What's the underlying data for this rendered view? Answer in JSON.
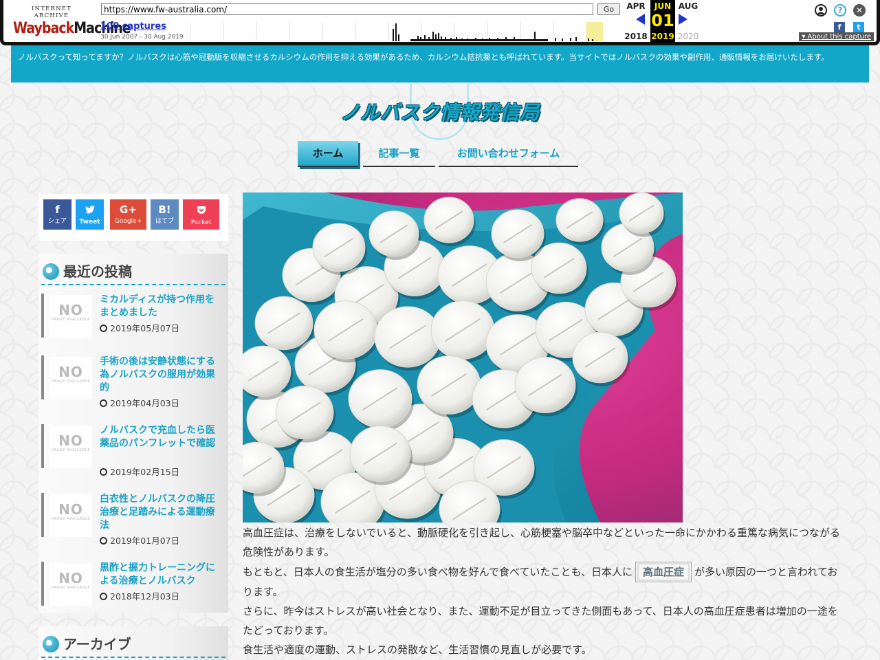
{
  "wayback": {
    "logo_top": "INTERNET ARCHIVE",
    "logo_main_1": "Wayback",
    "logo_main_2": "Machine",
    "url": "https://www.fw-australia.com/",
    "go_label": "Go",
    "captures": "100 captures",
    "range": "30 Jun 2007 - 30 Aug 2019",
    "months": {
      "prev": "APR",
      "current": "JUN",
      "next": "AUG"
    },
    "day": "01",
    "years": {
      "prev": "2018",
      "current": "2019",
      "next": "2020"
    },
    "about": "About this capture",
    "icons": [
      "user-icon",
      "help-icon",
      "close-icon",
      "facebook-icon",
      "twitter-icon"
    ],
    "sparkline": [
      0,
      0,
      0,
      0,
      0,
      0,
      0,
      0,
      0,
      0,
      0,
      0,
      0,
      0,
      0,
      0,
      0,
      0,
      0,
      0,
      0,
      0,
      0,
      0,
      0,
      0,
      0,
      0,
      0,
      0,
      0,
      0,
      0,
      0,
      0,
      0,
      0,
      0,
      0,
      0,
      0,
      0,
      0,
      0,
      0,
      0,
      0,
      0,
      0,
      0,
      0,
      0,
      0,
      0,
      0,
      0,
      0,
      0,
      0,
      0,
      0,
      0,
      0,
      0,
      0,
      0,
      0,
      0,
      0,
      0,
      0,
      0,
      0,
      0,
      0,
      0,
      0,
      0,
      0,
      0,
      0,
      0,
      0,
      0,
      0,
      0,
      0,
      0,
      0,
      0,
      0,
      0,
      0,
      0,
      0,
      0,
      0,
      0,
      0,
      0,
      0,
      0,
      0,
      0,
      0,
      0,
      0,
      0,
      0,
      0,
      0,
      0,
      0,
      0,
      0,
      0,
      0,
      0,
      0,
      0,
      0,
      0,
      0,
      0,
      0,
      0,
      0,
      0,
      0,
      0,
      0,
      0,
      0,
      0,
      0,
      0,
      0,
      0,
      0,
      0,
      0,
      0,
      0,
      0,
      0,
      0,
      0,
      0,
      0,
      0,
      0,
      0,
      0,
      0,
      0,
      0,
      0,
      0,
      0,
      0,
      0,
      0,
      0,
      0,
      0,
      0,
      0,
      0,
      0,
      0,
      0,
      0,
      0,
      0,
      0,
      0,
      0,
      0,
      0,
      0,
      0,
      0,
      0,
      0,
      0,
      0,
      0,
      0,
      0,
      0,
      0,
      0,
      0,
      0,
      0,
      0,
      0,
      0,
      0,
      0,
      0,
      0,
      0,
      0,
      0,
      0,
      0,
      0,
      0,
      0,
      0,
      0,
      0,
      0,
      0,
      0,
      0,
      0,
      0,
      0,
      0,
      0,
      0,
      0,
      0,
      0,
      0,
      0,
      0,
      0,
      0,
      0,
      0,
      0,
      0,
      0,
      0,
      0,
      0,
      0,
      0,
      0,
      0,
      0,
      0,
      0,
      0,
      0,
      0,
      0,
      0,
      0,
      0,
      0,
      0,
      0,
      0,
      0,
      0,
      0,
      0,
      0,
      0,
      0,
      0,
      0,
      0,
      0,
      0,
      0,
      0,
      0,
      0,
      0,
      0,
      0,
      0,
      0,
      0,
      0,
      0,
      0,
      0,
      0,
      0,
      0,
      0,
      0,
      0,
      0,
      0,
      0,
      0,
      0,
      0,
      0,
      0,
      0,
      0,
      0,
      0,
      0,
      0,
      0,
      0,
      2,
      4,
      9,
      2,
      0,
      0,
      0,
      0,
      0,
      0,
      0,
      0,
      0,
      0,
      0,
      0,
      0,
      0,
      0,
      0,
      0,
      0,
      0,
      0,
      0,
      0,
      0,
      0,
      0,
      0,
      0,
      0,
      0,
      0,
      0,
      0,
      0,
      0,
      0,
      0,
      0,
      0,
      0,
      0,
      0,
      0,
      0,
      0,
      0,
      0,
      0,
      0,
      0,
      0,
      0,
      0,
      0,
      0,
      0,
      0,
      0,
      0,
      0,
      0,
      0,
      0,
      0,
      0,
      0,
      0,
      0,
      0,
      0,
      0,
      0,
      0,
      0,
      0,
      0,
      0,
      0,
      0,
      0,
      0,
      0,
      0,
      0,
      0,
      0,
      0,
      0,
      0,
      0,
      0,
      0,
      0,
      0,
      0,
      0,
      0,
      0,
      0,
      0,
      0,
      0,
      0,
      0,
      0,
      0,
      0,
      0,
      0,
      0,
      0,
      0,
      0,
      0,
      0,
      0,
      0,
      0,
      0,
      0,
      0,
      0,
      0,
      0,
      0,
      0,
      0,
      0,
      0,
      0,
      0,
      0,
      0,
      0,
      0,
      0,
      0,
      0,
      0,
      0,
      0,
      0,
      0,
      0,
      0,
      0,
      0,
      0,
      0,
      0,
      0,
      0,
      0,
      0,
      0,
      0,
      0,
      0,
      0,
      0,
      0,
      0,
      0,
      0,
      0,
      0,
      0,
      0,
      0,
      0,
      0,
      0,
      0,
      0,
      0,
      0,
      0,
      0,
      0,
      0,
      0,
      0,
      0,
      0,
      0,
      0,
      0,
      0,
      0,
      0,
      0,
      0,
      0,
      0,
      0,
      0,
      0,
      0,
      0,
      0,
      0,
      0,
      0,
      0,
      0,
      0,
      0,
      0,
      0,
      0,
      0,
      0,
      0,
      0,
      0,
      0,
      0,
      0,
      0,
      0,
      0,
      0,
      0,
      0,
      0,
      0,
      0,
      0,
      0,
      0,
      0,
      0,
      0,
      0,
      0,
      0,
      0,
      0,
      0,
      0,
      0,
      0,
      0,
      0,
      0,
      0,
      0,
      0,
      0,
      0,
      0,
      0,
      0,
      0,
      0,
      0,
      0,
      0,
      0,
      0,
      0,
      0,
      0,
      0,
      0,
      0,
      0,
      0,
      0,
      0,
      0,
      0,
      0,
      0,
      0,
      0,
      0,
      0,
      0,
      0,
      0,
      0,
      0,
      0,
      0,
      0,
      0,
      0,
      0,
      0,
      0,
      0,
      0,
      0,
      0,
      0,
      0,
      0,
      0,
      0,
      0,
      0,
      0,
      0,
      0,
      0,
      0,
      0,
      0,
      0,
      0,
      0,
      0,
      0,
      0,
      0,
      0,
      0,
      0,
      0,
      0,
      0,
      0,
      0,
      0,
      0,
      0,
      0,
      0,
      0,
      0,
      0,
      0,
      0,
      0,
      0,
      0,
      0,
      0
    ]
  },
  "site": {
    "notice": "ノルバスクって知ってますか？ノルバスクは心筋や冠動脈を収縮させるカルシウムの作用を抑える効果があるため、カルシウム拮抗薬とも呼ばれています。当サイトではノルバスクの効果や副作用、通販情報をお届けいたします。",
    "title": "ノルバスク情報発信局",
    "nav": [
      {
        "label": "ホーム"
      },
      {
        "label": "記事一覧"
      },
      {
        "label": "お問い合わせフォーム"
      }
    ]
  },
  "share": [
    {
      "glyph": "f",
      "label": "シェア",
      "color": "#3b5998"
    },
    {
      "glyph": "🐦",
      "label": "Tweet",
      "color": "#1da1f2"
    },
    {
      "glyph": "G+",
      "label": "Google+",
      "color": "#dd4b39"
    },
    {
      "glyph": "B!",
      "label": "はてブ",
      "color": "#5d8ac1"
    },
    {
      "glyph": "♥",
      "label": "Pocket",
      "color": "#ef4056"
    }
  ],
  "sidebar": {
    "recent_title": "最近の投稿",
    "archive_title": "アーカイブ",
    "thumb_no": "NO",
    "thumb_sub": "IMAGE AVAILABLE",
    "posts": [
      {
        "title": "ミカルディスが持つ作用をまとめました",
        "date": "2019年05月07日"
      },
      {
        "title": "手術の後は安静状態にする為ノルバスクの服用が効果的",
        "date": "2019年04月03日"
      },
      {
        "title": "ノルバスクで充血したら医薬品のパンフレットで確認",
        "date": "2019年02月15日"
      },
      {
        "title": "白衣性とノルバスクの降圧治療と足踏みによる運動療法",
        "date": "2019年01月07日"
      },
      {
        "title": "黒酢と握力トレーニングによる治療とノルバスク",
        "date": "2018年12月03日"
      }
    ]
  },
  "article": {
    "p1": "高血圧症は、治療をしないでいると、動脈硬化を引き起し、心筋梗塞や脳卒中などといった一命にかかわる重篤な病気につながる危険性があります。",
    "p2_pre": "もともと、日本人の食生活が塩分の多い食べ物を好んで食べていたことも、日本人に",
    "p2_tag": "高血圧症",
    "p2_post": "が多い原因の一つと言われております。",
    "p3": "さらに、昨今はストレスが高い社会となり、また、運動不足が目立ってきた側面もあって、日本人の高血圧症患者は増加の一途をたどっております。",
    "p4": "食生活や適度の運動、ストレスの発散など、生活習慣の見直しが必要です。"
  }
}
